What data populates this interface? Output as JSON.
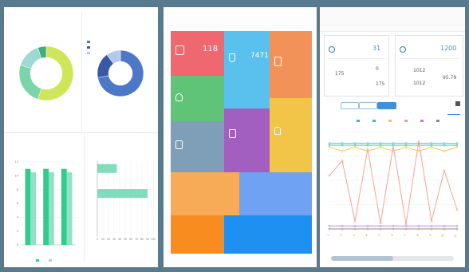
{
  "left_panel": {
    "charts": [
      {
        "type": "pie",
        "title": "",
        "subtitle": "",
        "values": [
          55,
          25,
          15,
          5
        ],
        "labels": [
          "",
          "",
          "",
          ""
        ],
        "colors": [
          "#cfe65a",
          "#7ad6a8",
          "#9fd9d3",
          "#3cae7f"
        ]
      },
      {
        "type": "pie",
        "title": "",
        "subtitle": "",
        "values": [
          72,
          18,
          10
        ],
        "labels": [
          "",
          "",
          ""
        ],
        "colors": [
          "#4d77c7",
          "#3b5aa6",
          "#b7c9ea"
        ],
        "legend": [
          "",
          "",
          ""
        ]
      },
      {
        "type": "bar",
        "title": "",
        "subtitle": "",
        "categories": [
          "",
          "",
          ""
        ],
        "series": [
          {
            "name": "",
            "values": [
              11,
              11,
              11
            ]
          },
          {
            "name": "",
            "values": [
              10.5,
              10.5,
              10.5
            ]
          }
        ],
        "ylim": [
          0,
          12
        ],
        "yticks": [
          "0",
          "2",
          "4",
          "6",
          "8",
          "10",
          "12"
        ],
        "colors": [
          "#2fcc8d",
          "#8fe2c3"
        ],
        "legend": [
          "",
          ""
        ]
      },
      {
        "type": "bar",
        "title": "",
        "subtitle": "",
        "orientation": "horizontal",
        "categories": [
          "",
          "",
          ""
        ],
        "values": [
          35,
          90,
          0
        ],
        "xlim": [
          0,
          100
        ],
        "xticks": [
          "0",
          "10",
          "20",
          "30",
          "40",
          "50",
          "60",
          "70",
          "80",
          "90",
          "100"
        ],
        "color": "#7fdcbc"
      }
    ]
  },
  "middle_panel": {
    "tiles": [
      {
        "id": "tile1",
        "label": "",
        "value": "118",
        "color": "#ef6870",
        "icon": "calendar-icon"
      },
      {
        "id": "tile2",
        "label": "",
        "value": "7471",
        "color": "#5ac0ee",
        "icon": "hourglass-icon"
      },
      {
        "id": "tile3",
        "label": "",
        "value": "",
        "color": "#f39258",
        "icon": "document-icon"
      },
      {
        "id": "tile4",
        "label": "",
        "value": "",
        "color": "#5fc477",
        "icon": "user-icon"
      },
      {
        "id": "tile5",
        "label": "",
        "value": "",
        "color": "#a35fbf",
        "icon": "clipboard-icon"
      },
      {
        "id": "tile6",
        "label": "",
        "value": "",
        "color": "#f2c447",
        "icon": "bell-icon"
      },
      {
        "id": "tile7",
        "label": "",
        "value": "",
        "color": "#7f9fb8",
        "icon": "list-icon"
      },
      {
        "id": "tile8",
        "label": "",
        "value": "",
        "color": "#f8ab57",
        "icon": ""
      },
      {
        "id": "tile9",
        "label": "",
        "value": "",
        "color": "#6fa2f2",
        "icon": ""
      },
      {
        "id": "tile10",
        "label": "",
        "value": "",
        "color": "#f98c1f",
        "icon": ""
      },
      {
        "id": "tile11",
        "label": "",
        "value": "",
        "color": "#1e90f2",
        "icon": ""
      }
    ]
  },
  "right_panel": {
    "breadcrumb": "",
    "card1": {
      "title": "",
      "value": "31",
      "sub": [
        "175",
        "0",
        "175"
      ]
    },
    "card2": {
      "title": "",
      "value": "1200",
      "sub": [
        "1012",
        "1012",
        "95.79"
      ]
    },
    "section_label": "",
    "tabs": [
      "",
      "",
      ""
    ],
    "active_tab": 2,
    "chart_data": {
      "type": "line",
      "categories": [
        "1",
        "2",
        "3",
        "4",
        "5",
        "6",
        "7",
        "8",
        "9",
        "10",
        "11"
      ],
      "ylim": [
        0,
        100
      ],
      "series": [
        {
          "name": "",
          "color": "#3ab3e6",
          "values": [
            88,
            88,
            88,
            88,
            88,
            88,
            88,
            88,
            88,
            88,
            88
          ]
        },
        {
          "name": "",
          "color": "#2fcc8d",
          "values": [
            86,
            86,
            86,
            86,
            86,
            86,
            86,
            86,
            86,
            86,
            86
          ]
        },
        {
          "name": "",
          "color": "#f2c447",
          "values": [
            84,
            80,
            84,
            80,
            84,
            80,
            84,
            80,
            84,
            80,
            84
          ]
        },
        {
          "name": "",
          "color": "#f59a8a",
          "values": [
            55,
            70,
            8,
            82,
            6,
            85,
            5,
            90,
            8,
            60,
            20
          ]
        },
        {
          "name": "",
          "color": "#c07ad9",
          "values": [
            3,
            3,
            3,
            3,
            3,
            3,
            3,
            3,
            3,
            3,
            3
          ]
        },
        {
          "name": "",
          "color": "#888888",
          "values": [
            0,
            0,
            0,
            0,
            0,
            0,
            0,
            0,
            0,
            0,
            0
          ]
        }
      ]
    }
  }
}
